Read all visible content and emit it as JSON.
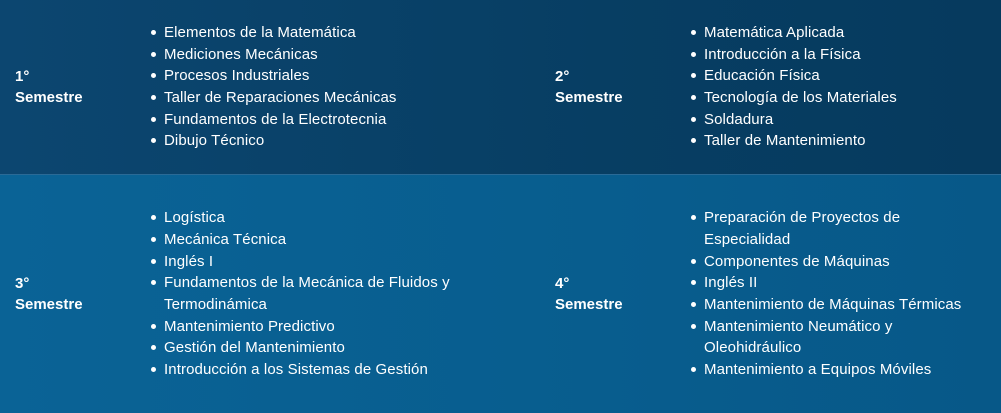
{
  "semesters": [
    {
      "number": "1°",
      "label": "Semestre",
      "courses": [
        "Elementos de la Matemática",
        "Mediciones Mecánicas",
        "Procesos Industriales",
        "Taller de Reparaciones Mecánicas",
        "Fundamentos de la Electrotecnia",
        "Dibujo Técnico"
      ]
    },
    {
      "number": "2°",
      "label": "Semestre",
      "courses": [
        "Matemática Aplicada",
        "Introducción a la Física",
        "Educación Física",
        "Tecnología de los Materiales",
        "Soldadura",
        "Taller de Mantenimiento"
      ]
    },
    {
      "number": "3°",
      "label": "Semestre",
      "courses": [
        "Logística",
        "Mecánica Técnica",
        "Inglés I",
        "Fundamentos de la Mecánica de Fluidos y Termodinámica",
        "Mantenimiento Predictivo",
        "Gestión del Mantenimiento",
        "Introducción a los Sistemas de Gestión"
      ]
    },
    {
      "number": "4°",
      "label": "Semestre",
      "courses": [
        "Preparación de Proyectos de Especialidad",
        "Componentes de Máquinas",
        "Inglés II",
        "Mantenimiento de Máquinas Térmicas",
        "Mantenimiento Neumático y Oleohidráulico",
        "Mantenimiento a Equipos Móviles"
      ]
    }
  ]
}
